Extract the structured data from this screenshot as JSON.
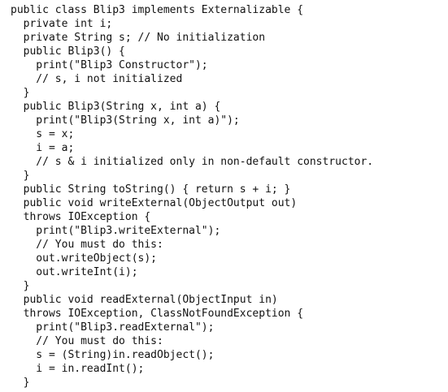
{
  "code_lines": [
    "public class Blip3 implements Externalizable {",
    "  private int i;",
    "  private String s; // No initialization",
    "  public Blip3() {",
    "    print(\"Blip3 Constructor\");",
    "    // s, i not initialized",
    "  }",
    "  public Blip3(String x, int a) {",
    "    print(\"Blip3(String x, int a)\");",
    "    s = x;",
    "    i = a;",
    "    // s & i initialized only in non-default constructor.",
    "  }",
    "  public String toString() { return s + i; }",
    "  public void writeExternal(ObjectOutput out)",
    "  throws IOException {",
    "    print(\"Blip3.writeExternal\");",
    "    // You must do this:",
    "    out.writeObject(s);",
    "    out.writeInt(i);",
    "  }",
    "  public void readExternal(ObjectInput in)",
    "  throws IOException, ClassNotFoundException {",
    "    print(\"Blip3.readExternal\");",
    "    // You must do this:",
    "    s = (String)in.readObject();",
    "    i = in.readInt();",
    "  }"
  ]
}
